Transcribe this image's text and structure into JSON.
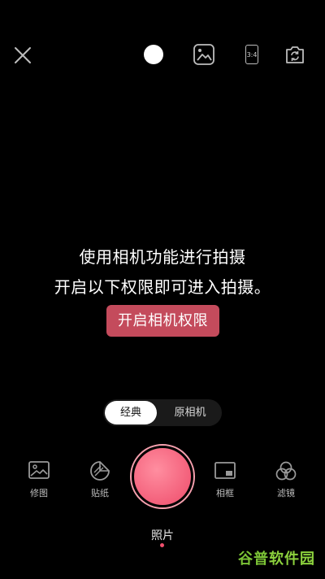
{
  "topbar": {
    "icons": {
      "close": "close-icon",
      "flash": "flash-dot-icon",
      "gallery": "gallery-icon",
      "switch": "camera-switch-icon"
    },
    "ratio_label": "3:4"
  },
  "permission": {
    "line1": "使用相机功能进行拍摄",
    "line2": "开启以下权限即可进入拍摄。",
    "button_label": "开启相机权限",
    "button_color": "#c44b5c"
  },
  "mode_toggle": {
    "options": [
      "经典",
      "原相机"
    ],
    "selected": "经典"
  },
  "tools": {
    "edit_label": "修图",
    "sticker_label": "贴纸",
    "frame_label": "相框",
    "filter_label": "滤镜"
  },
  "shutter": {
    "color": "#f35f7a"
  },
  "capture_mode": {
    "label": "照片"
  },
  "watermark": {
    "part1": "谷普",
    "part2": "软件园"
  }
}
